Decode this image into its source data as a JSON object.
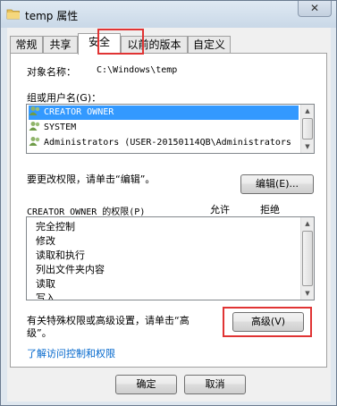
{
  "window": {
    "title": "temp 属性",
    "close_glyph": "✕"
  },
  "tabs": [
    "常规",
    "共享",
    "安全",
    "以前的版本",
    "自定义"
  ],
  "security": {
    "object_name_label": "对象名称：",
    "object_name_value": "C:\\Windows\\temp",
    "groups_label": "组或用户名(G)：",
    "groups": [
      "CREATOR OWNER",
      "SYSTEM",
      "Administrators (USER-20150114QB\\Administrators"
    ],
    "change_hint": "要更改权限，请单击“编辑”。",
    "edit_button": "编辑(E)...",
    "perm_header": "CREATOR OWNER 的权限(P)",
    "allow_label": "允许",
    "deny_label": "拒绝",
    "permissions": [
      "完全控制",
      "修改",
      "读取和执行",
      "列出文件夹内容",
      "读取",
      "写入"
    ],
    "advanced_hint_line1": "有关特殊权限或高级设置，请单击“高",
    "advanced_hint_line2": "级”。",
    "advanced_button": "高级(V)",
    "learn_link": "了解访问控制和权限"
  },
  "footer": {
    "ok_button": "确定",
    "cancel_button": "取消"
  },
  "colors": {
    "selection": "#3399ff",
    "highlight_box": "#e03434",
    "link": "#0066cc"
  }
}
